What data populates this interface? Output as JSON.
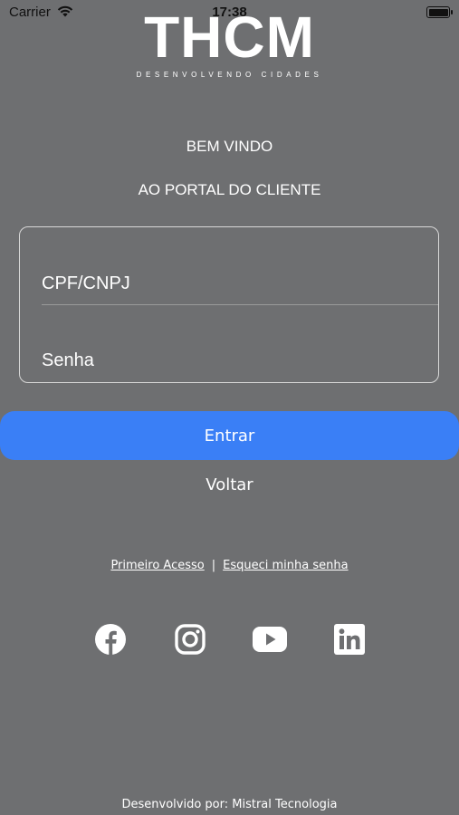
{
  "status_bar": {
    "carrier": "Carrier",
    "time": "17:38"
  },
  "logo": {
    "mark": "THCM",
    "tagline": "DESENVOLVENDO CIDADES"
  },
  "welcome": {
    "line1": "BEM VINDO",
    "line2": "AO PORTAL DO CLIENTE"
  },
  "login_form": {
    "cpf_placeholder": "CPF/CNPJ",
    "password_placeholder": "Senha"
  },
  "actions": {
    "enter_label": "Entrar",
    "back_label": "Voltar"
  },
  "links": {
    "first_access": " Primeiro Acesso",
    "separator": "|",
    "forgot_password": "Esqueci minha senha "
  },
  "social": [
    "facebook-icon",
    "instagram-icon",
    "youtube-icon",
    "linkedin-icon"
  ],
  "footer": {
    "credit": "Desenvolvido por: Mistral Tecnologia"
  },
  "colors": {
    "background": "#6e6f71",
    "accent": "#3a7ff6",
    "text": "#ffffff"
  }
}
